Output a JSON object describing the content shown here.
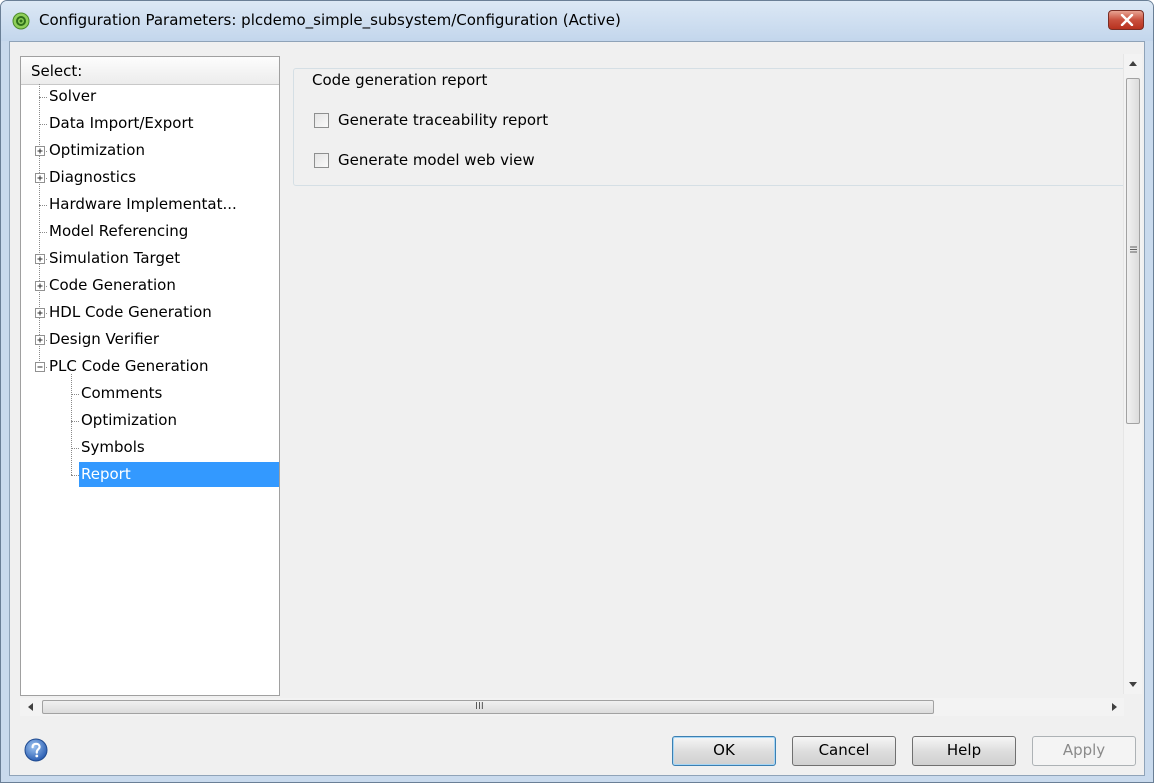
{
  "window": {
    "title": "Configuration Parameters: plcdemo_simple_subsystem/Configuration (Active)"
  },
  "tree": {
    "header": "Select:",
    "items": [
      {
        "label": "Solver",
        "level": 0,
        "expander": "none"
      },
      {
        "label": "Data Import/Export",
        "level": 0,
        "expander": "none"
      },
      {
        "label": "Optimization",
        "level": 0,
        "expander": "plus"
      },
      {
        "label": "Diagnostics",
        "level": 0,
        "expander": "plus"
      },
      {
        "label": "Hardware Implementat...",
        "level": 0,
        "expander": "none"
      },
      {
        "label": "Model Referencing",
        "level": 0,
        "expander": "none"
      },
      {
        "label": "Simulation Target",
        "level": 0,
        "expander": "plus"
      },
      {
        "label": "Code Generation",
        "level": 0,
        "expander": "plus"
      },
      {
        "label": "HDL Code Generation",
        "level": 0,
        "expander": "plus"
      },
      {
        "label": "Design Verifier",
        "level": 0,
        "expander": "plus"
      },
      {
        "label": "PLC Code Generation",
        "level": 0,
        "expander": "minus"
      },
      {
        "label": "Comments",
        "level": 1,
        "expander": "none"
      },
      {
        "label": "Optimization",
        "level": 1,
        "expander": "none"
      },
      {
        "label": "Symbols",
        "level": 1,
        "expander": "none"
      },
      {
        "label": "Report",
        "level": 1,
        "expander": "none",
        "selected": true
      }
    ]
  },
  "panel": {
    "group_title": "Code generation report",
    "checkboxes": [
      {
        "label": "Generate traceability report",
        "checked": false
      },
      {
        "label": "Generate model web view",
        "checked": false
      }
    ]
  },
  "scrollbar": {
    "h_grip": "III"
  },
  "buttons": {
    "ok": "OK",
    "cancel": "Cancel",
    "help": "Help",
    "apply": "Apply"
  },
  "colors": {
    "selection": "#3399ff",
    "title_bar": "#c9daed",
    "close_button": "#c9503d"
  }
}
